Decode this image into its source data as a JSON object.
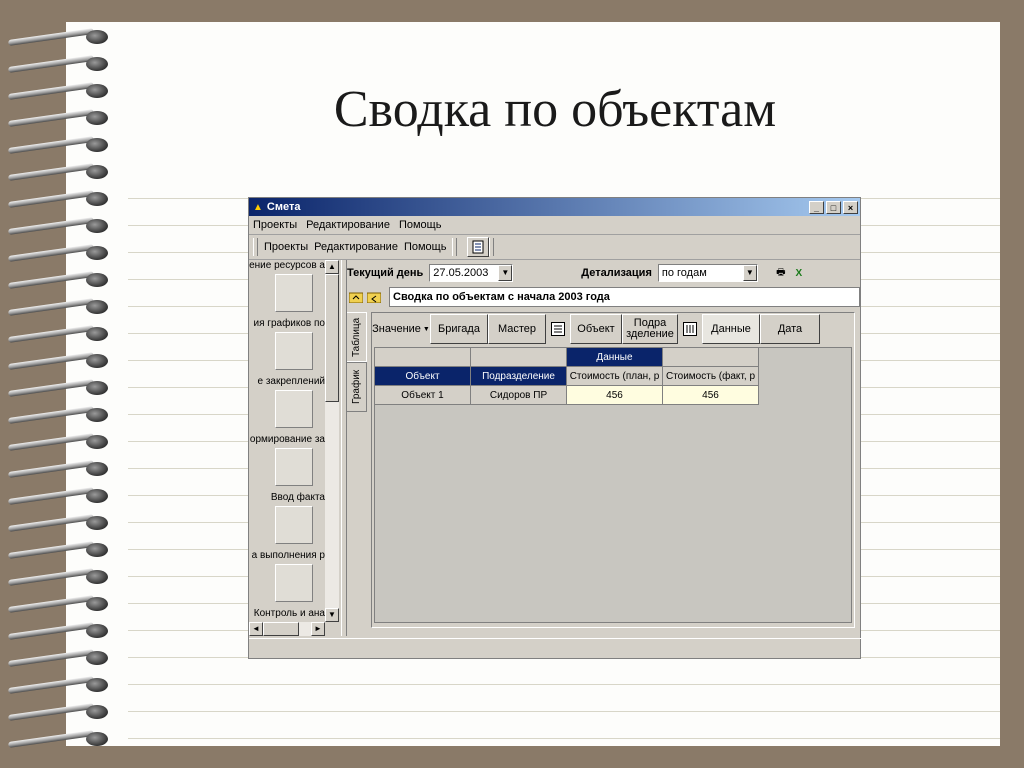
{
  "slide": {
    "title": "Сводка по объектам"
  },
  "window": {
    "title": "Смета",
    "controls": {
      "minimize": "_",
      "maximize": "□",
      "close": "×"
    },
    "menu": [
      "Проекты",
      "Редактирование",
      "Помощь"
    ],
    "toolbar": [
      "Проекты",
      "Редактирование",
      "Помощь"
    ]
  },
  "left_panel": {
    "items": [
      "ение ресурсов а",
      "ия графиков по",
      "е закреплений",
      "ормирование за",
      "Ввод факта",
      "а выполнения р",
      "Контроль и ана"
    ]
  },
  "filter": {
    "current_day_label": "Текущий день",
    "current_day_value": "27.05.2003",
    "detail_label": "Детализация",
    "detail_value": "по годам"
  },
  "report_title": "Сводка по объектам с начала 2003 года",
  "tabs": [
    "Таблица",
    "График"
  ],
  "pivot_fields": {
    "value_btn": "Значение",
    "brigade": "Бригада",
    "master": "Мастер",
    "object": "Объект",
    "subdivision_line1": "Подра",
    "subdivision_line2": "зделение",
    "data": "Данные",
    "date": "Дата"
  },
  "grid": {
    "data_header": "Данные",
    "columns": [
      "Объект",
      "Подразделение",
      "Стоимость (план, р",
      "Стоимость (факт, р"
    ],
    "rows": [
      {
        "object": "Объект 1",
        "subdivision": "Сидоров ПР",
        "plan": "456",
        "fact": "456"
      }
    ]
  },
  "colors": {
    "titlebar": "#0a246a",
    "header_cell": "#0a246a",
    "data_cell": "#fffde0",
    "window_bg": "#d4d0c8"
  }
}
